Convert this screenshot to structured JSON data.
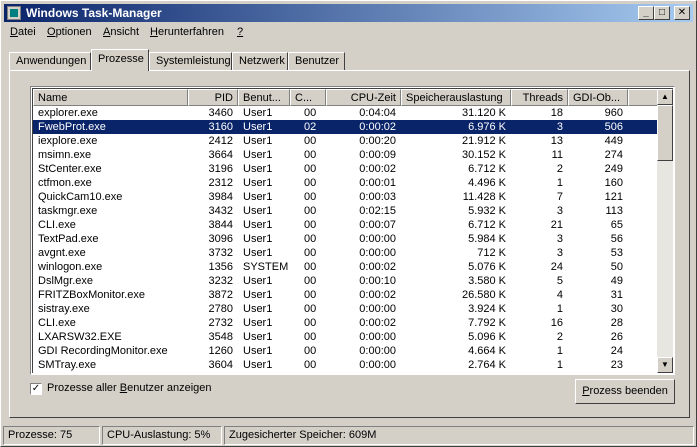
{
  "window": {
    "title": "Windows Task-Manager",
    "min_glyph": "_",
    "max_glyph": "□",
    "close_glyph": "✕"
  },
  "menu": [
    {
      "label": "Datei",
      "key": "D",
      "rest": "atei"
    },
    {
      "label": "Optionen",
      "key": "O",
      "rest": "ptionen"
    },
    {
      "label": "Ansicht",
      "key": "A",
      "rest": "nsicht"
    },
    {
      "label": "Herunterfahren",
      "key": "H",
      "rest": "erunterfahren"
    },
    {
      "label": "?",
      "key": "?",
      "rest": ""
    }
  ],
  "tabs": [
    "Anwendungen",
    "Prozesse",
    "Systemleistung",
    "Netzwerk",
    "Benutzer"
  ],
  "active_tab": "Prozesse",
  "columns": [
    "Name",
    "PID",
    "Benut...",
    "C...",
    "CPU-Zeit",
    "Speicherauslastung",
    "Threads",
    "GDI-Ob..."
  ],
  "rows": [
    [
      "explorer.exe",
      "3460",
      "User1",
      "00",
      "0:04:04",
      "31.120 K",
      "18",
      "960"
    ],
    [
      "FwebProt.exe",
      "3160",
      "User1",
      "02",
      "0:00:02",
      "6.976 K",
      "3",
      "506"
    ],
    [
      "iexplore.exe",
      "2412",
      "User1",
      "00",
      "0:00:20",
      "21.912 K",
      "13",
      "449"
    ],
    [
      "msimn.exe",
      "3664",
      "User1",
      "00",
      "0:00:09",
      "30.152 K",
      "11",
      "274"
    ],
    [
      "StCenter.exe",
      "3196",
      "User1",
      "00",
      "0:00:02",
      "6.712 K",
      "2",
      "249"
    ],
    [
      "ctfmon.exe",
      "2312",
      "User1",
      "00",
      "0:00:01",
      "4.496 K",
      "1",
      "160"
    ],
    [
      "QuickCam10.exe",
      "3984",
      "User1",
      "00",
      "0:00:03",
      "11.428 K",
      "7",
      "121"
    ],
    [
      "taskmgr.exe",
      "3432",
      "User1",
      "00",
      "0:02:15",
      "5.932 K",
      "3",
      "113"
    ],
    [
      "CLI.exe",
      "3844",
      "User1",
      "00",
      "0:00:07",
      "6.712 K",
      "21",
      "65"
    ],
    [
      "TextPad.exe",
      "3096",
      "User1",
      "00",
      "0:00:00",
      "5.984 K",
      "3",
      "56"
    ],
    [
      "avgnt.exe",
      "3732",
      "User1",
      "00",
      "0:00:00",
      "712 K",
      "3",
      "53"
    ],
    [
      "winlogon.exe",
      "1356",
      "SYSTEM",
      "00",
      "0:00:02",
      "5.076 K",
      "24",
      "50"
    ],
    [
      "DslMgr.exe",
      "3232",
      "User1",
      "00",
      "0:00:10",
      "3.580 K",
      "5",
      "49"
    ],
    [
      "FRITZBoxMonitor.exe",
      "3872",
      "User1",
      "00",
      "0:00:02",
      "26.580 K",
      "4",
      "31"
    ],
    [
      "sistray.exe",
      "2780",
      "User1",
      "00",
      "0:00:00",
      "3.924 K",
      "1",
      "30"
    ],
    [
      "CLI.exe",
      "2732",
      "User1",
      "00",
      "0:00:02",
      "7.792 K",
      "16",
      "28"
    ],
    [
      "LXARSW32.EXE",
      "3548",
      "User1",
      "00",
      "0:00:00",
      "5.096 K",
      "2",
      "26"
    ],
    [
      "GDI RecordingMonitor.exe",
      "1260",
      "User1",
      "00",
      "0:00:00",
      "4.664 K",
      "1",
      "24"
    ],
    [
      "SMTray.exe",
      "3604",
      "User1",
      "00",
      "0:00:00",
      "2.764 K",
      "1",
      "23"
    ]
  ],
  "selected_row": 1,
  "show_all_users": {
    "label_pre": "Prozesse aller ",
    "key": "B",
    "label_post": "enutzer anzeigen",
    "checked": true,
    "glyph": "✓"
  },
  "end_process_button": {
    "pre": "",
    "key": "P",
    "post": "rozess beenden"
  },
  "statusbar": {
    "processes": "Prozesse: 75",
    "cpu": "CPU-Auslastung: 5%",
    "memory": "Zugesicherter Speicher: 609M"
  },
  "scroll": {
    "up_glyph": "▲",
    "down_glyph": "▼"
  }
}
